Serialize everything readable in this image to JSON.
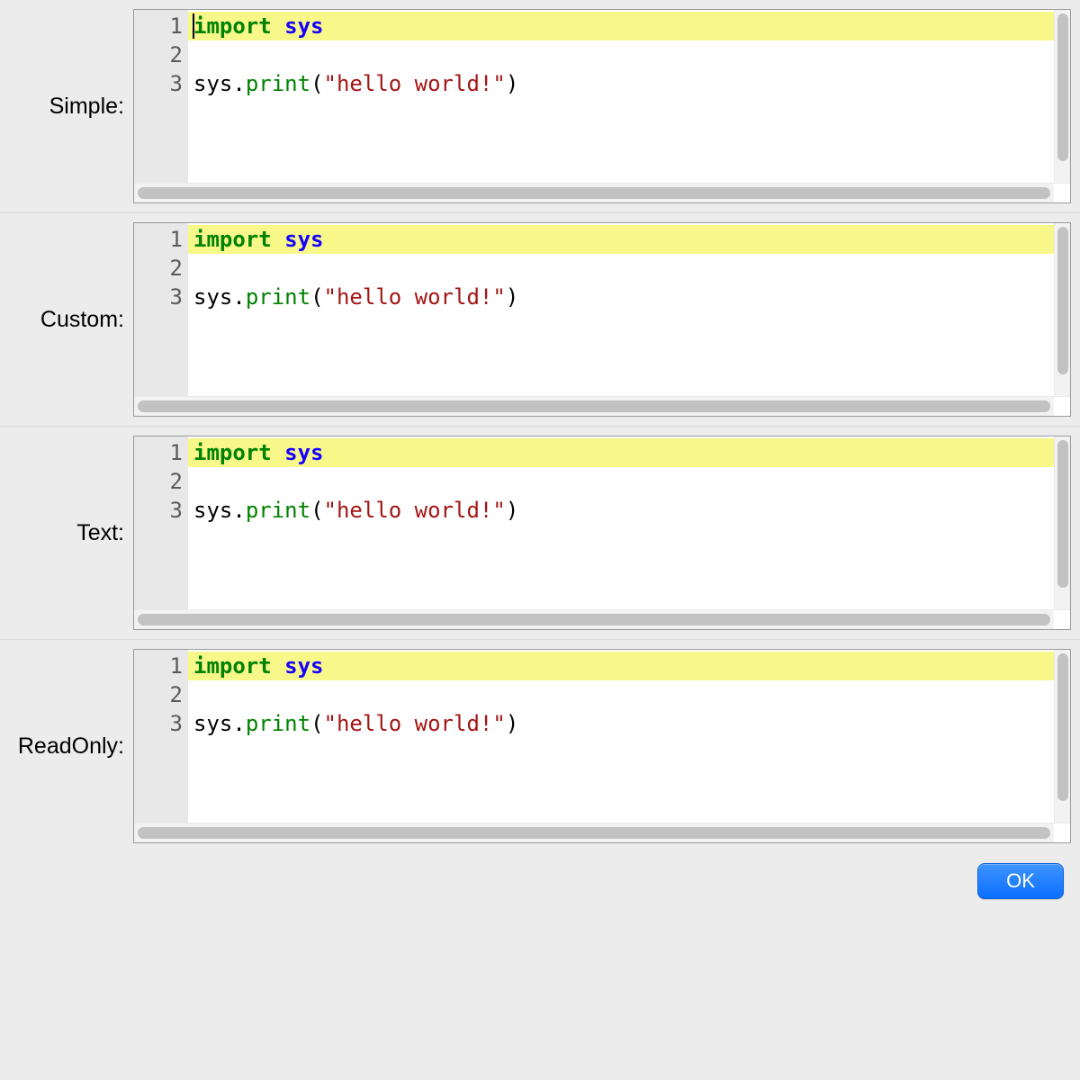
{
  "rows": [
    {
      "id": "simple",
      "label": "Simple:"
    },
    {
      "id": "custom",
      "label": "Custom:"
    },
    {
      "id": "text",
      "label": "Text:"
    },
    {
      "id": "readonly",
      "label": "ReadOnly:"
    }
  ],
  "code": {
    "line_numbers": [
      "1",
      "2",
      "3"
    ],
    "highlighted_line_index": 0,
    "caret_on_first_editor": true,
    "lines": [
      [
        {
          "t": "import",
          "cls": "tok-kw"
        },
        {
          "t": " ",
          "cls": "tok-punct"
        },
        {
          "t": "sys",
          "cls": "tok-id"
        }
      ],
      [],
      [
        {
          "t": "sys",
          "cls": "tok-punct"
        },
        {
          "t": ".",
          "cls": "tok-punct"
        },
        {
          "t": "print",
          "cls": "tok-fn"
        },
        {
          "t": "(",
          "cls": "tok-punct"
        },
        {
          "t": "\"hello world!\"",
          "cls": "tok-str"
        },
        {
          "t": ")",
          "cls": "tok-punct"
        }
      ]
    ]
  },
  "buttons": {
    "ok": "OK"
  },
  "colors": {
    "keyword": "#008200",
    "identifier": "#1500ff",
    "string": "#a31515",
    "line_highlight": "#f7f78a",
    "accent": "#1a7bff"
  }
}
